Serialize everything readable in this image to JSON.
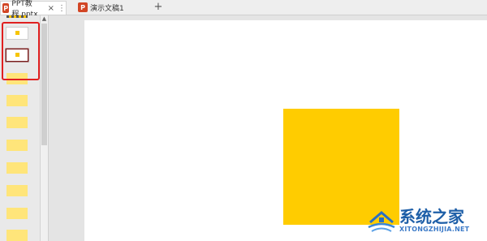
{
  "tabs": [
    {
      "label": "PPT教程.pptx",
      "icon": "ppt-file-icon",
      "active": true,
      "close": "×",
      "more": "⋮"
    },
    {
      "label": "演示文稿1",
      "icon": "ppt-file-icon",
      "active": false
    }
  ],
  "add_tab": "+",
  "thumbnails_count": 10,
  "colors": {
    "shape_fill": "#ffcc00",
    "highlight_border": "#e02020",
    "selected_border": "#7a1f1f"
  },
  "watermark": {
    "title": "系统之家",
    "url": "XITONGZHIJIA.NET"
  }
}
